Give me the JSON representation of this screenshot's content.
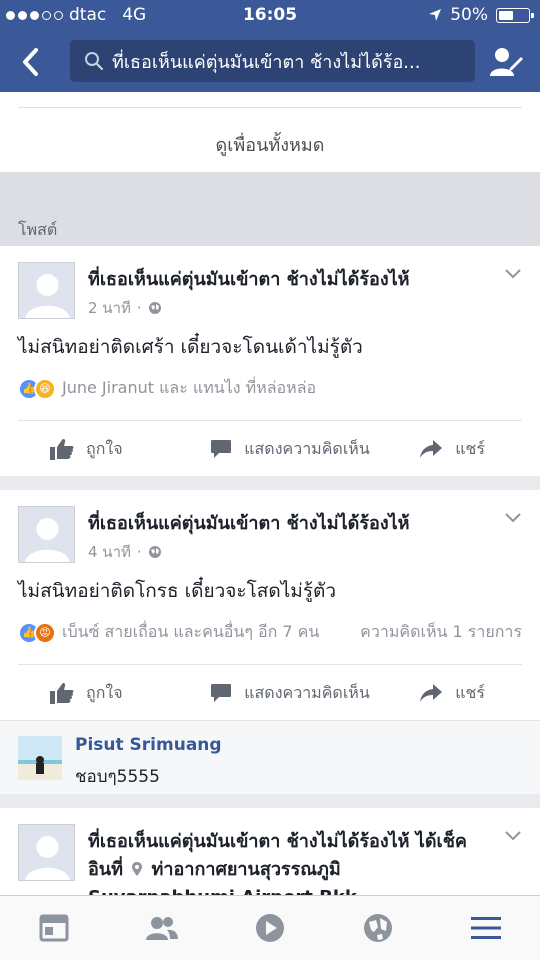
{
  "status": {
    "carrier": "dtac",
    "network": "4G",
    "time": "16:05",
    "battery": "50%",
    "battery_level": 0.5
  },
  "search": {
    "query": "ที่เธอเห็นแค่ตุ่นมันเข้าตา ช้างไม่ได้ร้อ..."
  },
  "see_all": "ดูเพื่อนทั้งหมด",
  "section_title": "โพสต์",
  "posts": [
    {
      "author": "ที่เธอเห็นแค่ตุ่นมันเข้าตา ช้างไม่ได้ร้องไห้",
      "time": "2 นาที",
      "text": "ไม่สนิทอย่าติดเศร้า เดี๋ยวจะโดนเด้าไม่รู้ตัว",
      "reactions": "June Jiranut และ แทนไง ที่หล่อหล่อ",
      "comments_count": ""
    },
    {
      "author": "ที่เธอเห็นแค่ตุ่นมันเข้าตา ช้างไม่ได้ร้องไห้",
      "time": "4 นาที",
      "text": "ไม่สนิทอย่าติดโกรธ เดี๋ยวจะโสดไม่รู้ตัว",
      "reactions": "เบ็นซ์ สายเถื่อน และคนอื่นๆ อีก 7 คน",
      "comments_count": "ความคิดเห็น 1 รายการ",
      "comment": {
        "name": "Pisut Srimuang",
        "text": "ชอบๆ5555"
      }
    },
    {
      "author": "ที่เธอเห็นแค่ตุ่นมันเข้าตา ช้างไม่ได้ร้องไห้ ได้เช็คอินที่",
      "place": "ท่าอากาศยานสุวรรณภูมิ Suvarnabhumi Airport Bkk"
    }
  ],
  "actions": {
    "like": "ถูกใจ",
    "comment": "แสดงความคิดเห็น",
    "share": "แชร์"
  },
  "colors": {
    "brand": "#3b5998",
    "link": "#365899",
    "tab_active": "#3b5998"
  },
  "tabs": [
    "news-feed",
    "friends",
    "video",
    "notifications",
    "menu"
  ]
}
